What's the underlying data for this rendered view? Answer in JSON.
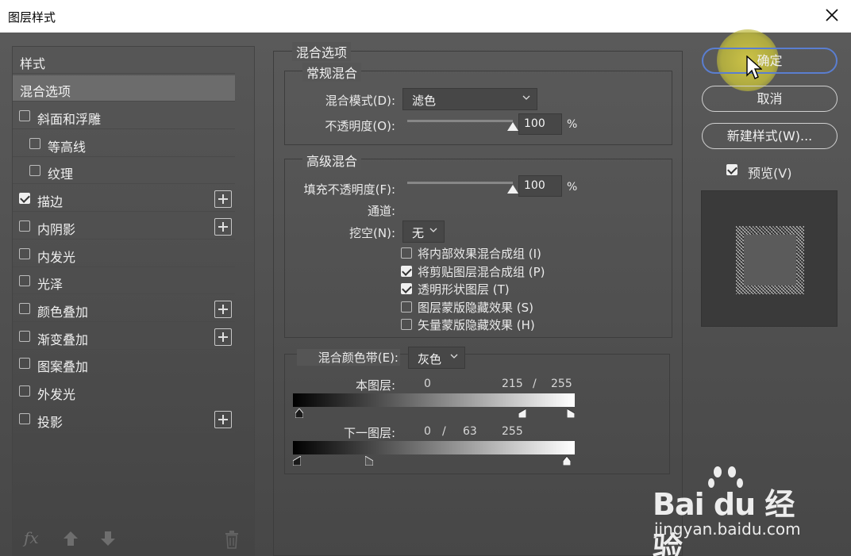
{
  "window": {
    "title": "图层样式",
    "close_icon": "close-icon"
  },
  "styles_panel": {
    "header": "样式",
    "selected": "混合选项",
    "items": [
      {
        "label": "斜面和浮雕",
        "checked": false,
        "indent": false,
        "plus": false
      },
      {
        "label": "等高线",
        "checked": false,
        "indent": true,
        "plus": false
      },
      {
        "label": "纹理",
        "checked": false,
        "indent": true,
        "plus": false
      },
      {
        "label": "描边",
        "checked": true,
        "indent": false,
        "plus": true
      },
      {
        "label": "内阴影",
        "checked": false,
        "indent": false,
        "plus": true
      },
      {
        "label": "内发光",
        "checked": false,
        "indent": false,
        "plus": false
      },
      {
        "label": "光泽",
        "checked": false,
        "indent": false,
        "plus": false
      },
      {
        "label": "颜色叠加",
        "checked": false,
        "indent": false,
        "plus": true
      },
      {
        "label": "渐变叠加",
        "checked": false,
        "indent": false,
        "plus": true
      },
      {
        "label": "图案叠加",
        "checked": false,
        "indent": false,
        "plus": false
      },
      {
        "label": "外发光",
        "checked": false,
        "indent": false,
        "plus": false
      },
      {
        "label": "投影",
        "checked": false,
        "indent": false,
        "plus": true
      }
    ],
    "bottom_icons": [
      "fx-icon",
      "arrow-up-icon",
      "arrow-down-icon",
      "trash-icon"
    ],
    "fx_label": "fx"
  },
  "blending": {
    "section_title": "混合选项",
    "general": {
      "title": "常规混合",
      "mode_label": "混合模式(D):",
      "mode_value": "滤色",
      "opacity_label": "不透明度(O):",
      "opacity_value": "100",
      "opacity_level": 1.0,
      "unit": "%"
    },
    "advanced": {
      "title": "高级混合",
      "fill_label": "填充不透明度(F):",
      "fill_value": "100",
      "fill_level": 1.0,
      "unit": "%",
      "channels_label": "通道:",
      "knockout_label": "挖空(N):",
      "knockout_value": "无",
      "options": [
        {
          "label": "将内部效果混合成组 (I)",
          "checked": false
        },
        {
          "label": "将剪贴图层混合成组 (P)",
          "checked": true
        },
        {
          "label": "透明形状图层 (T)",
          "checked": true
        },
        {
          "label": "图层蒙版隐藏效果 (S)",
          "checked": false
        },
        {
          "label": "矢量蒙版隐藏效果 (H)",
          "checked": false
        }
      ]
    },
    "blend_if": {
      "label": "混合颜色带(E):",
      "channel_value": "灰色",
      "this_layer_label": "本图层:",
      "this_layer_values": [
        "0",
        "215",
        "/",
        "255"
      ],
      "underlying_label": "下一图层:",
      "underlying_values": [
        "0",
        "/",
        "63",
        "255"
      ]
    }
  },
  "buttons": {
    "ok": "确定",
    "cancel": "取消",
    "new_style": "新建样式(W)...",
    "preview_label": "预览(V)",
    "preview_checked": true
  },
  "watermark": {
    "brand": "Bai du 经验",
    "url": "jingyan.baidu.com"
  },
  "colors": {
    "accent": "#5a7ed0",
    "highlight": "#d2c846"
  }
}
